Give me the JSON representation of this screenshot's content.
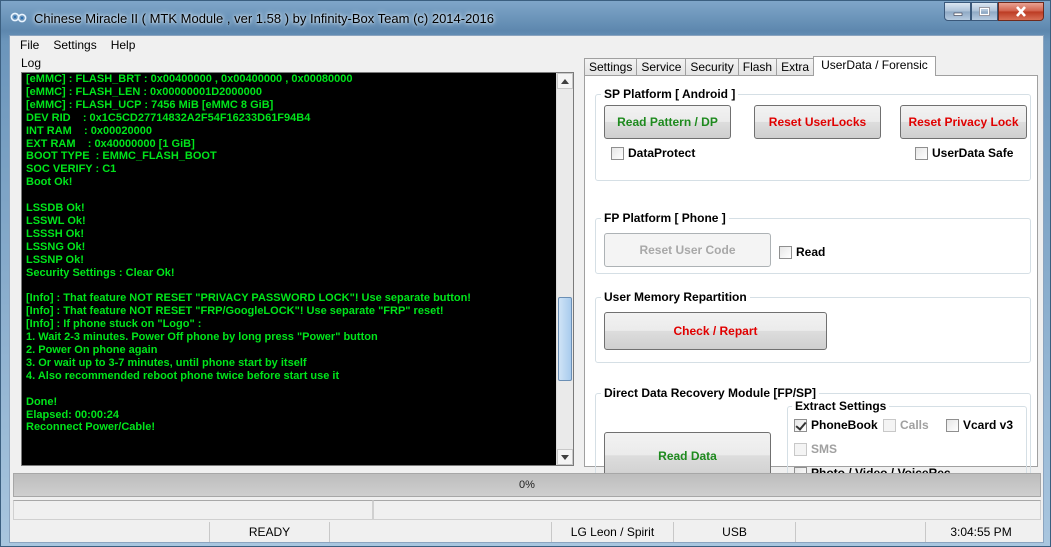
{
  "window": {
    "title": "Chinese Miracle II ( MTK Module , ver 1.58 ) by Infinity-Box Team (c) 2014-2016"
  },
  "menu": [
    "File",
    "Settings",
    "Help"
  ],
  "log": {
    "label": "Log",
    "lines": [
      "[eMMC] : FLASH_BRT : 0x00400000 , 0x00400000 , 0x00080000",
      "[eMMC] : FLASH_LEN : 0x00000001D2000000",
      "[eMMC] : FLASH_UCP : 7456 MiB [eMMC 8 GiB]",
      "DEV RID    : 0x1C5CD27714832A2F54F16233D61F94B4",
      "INT RAM    : 0x00020000",
      "EXT RAM    : 0x40000000 [1 GiB]",
      "BOOT TYPE  : EMMC_FLASH_BOOT",
      "SOC VERIFY : C1",
      "Boot Ok!",
      "",
      "LSSDB Ok!",
      "LSSWL Ok!",
      "LSSSH Ok!",
      "LSSNG Ok!",
      "LSSNP Ok!",
      "Security Settings : Clear Ok!",
      "",
      "[Info] : That feature NOT RESET \"PRIVACY PASSWORD LOCK\"! Use separate button!",
      "[Info] : That feature NOT RESET \"FRP/GoogleLOCK\"! Use separate \"FRP\" reset!",
      "[Info] : If phone stuck on \"Logo\" :",
      "1. Wait 2-3 minutes. Power Off phone by long press \"Power\" button",
      "2. Power On phone again",
      "3. Or wait up to 3-7 minutes, until phone start by itself",
      "4. Also recommended reboot phone twice before start use it",
      "",
      "Done!",
      "Elapsed: 00:00:24",
      "Reconnect Power/Cable!"
    ]
  },
  "tabs": [
    "Settings",
    "Service",
    "Security",
    "Flash",
    "Extra",
    "UserData / Forensic"
  ],
  "active_tab": "UserData / Forensic",
  "sp_platform": {
    "title": "SP Platform [ Android ]",
    "read_pattern": "Read Pattern / DP",
    "reset_userlocks": "Reset UserLocks",
    "reset_privacy": "Reset Privacy Lock",
    "dataprotect": "DataProtect",
    "userdata_safe": "UserData Safe"
  },
  "fp_platform": {
    "title": "FP Platform [ Phone ]",
    "reset_user_code": "Reset User Code",
    "read": "Read"
  },
  "user_memory": {
    "title": "User Memory Repartition",
    "check_repart": "Check / Repart"
  },
  "recovery": {
    "title": "Direct Data Recovery Module  [FP/SP]",
    "read_data": "Read Data",
    "extract_title": "Extract Settings",
    "phonebook": "PhoneBook",
    "calls": "Calls",
    "vcard": "Vcard v3",
    "sms": "SMS",
    "photo": "Photo / Video / VoiceRec",
    "phonebook_checked": true
  },
  "progress": {
    "text": "0%",
    "value": 0
  },
  "status": {
    "state": "READY",
    "device": "LG Leon / Spirit",
    "port": "USB",
    "time": "3:04:55 PM"
  },
  "colors": {
    "log_bg": "#000000",
    "log_text": "#00e51b",
    "green_button": "#1e8a1e",
    "red_button": "#e00000"
  }
}
